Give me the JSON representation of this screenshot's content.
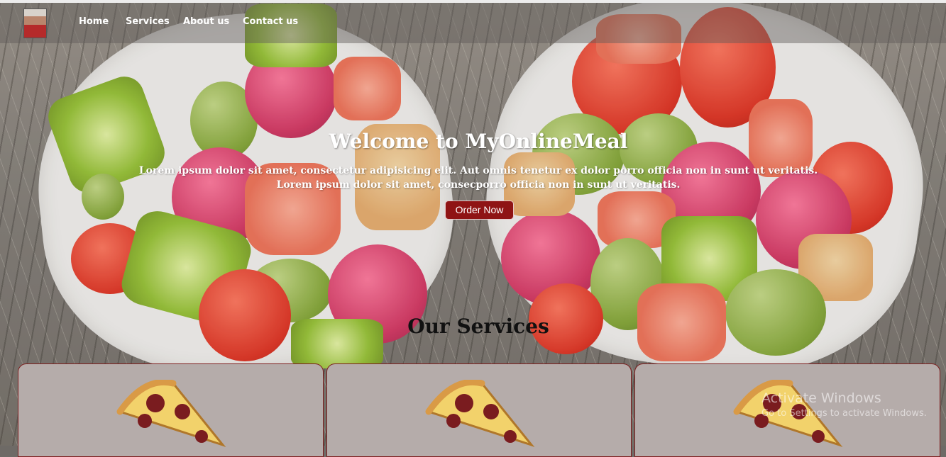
{
  "nav": {
    "links": [
      "Home",
      "Services",
      "About us",
      "Contact us"
    ]
  },
  "hero": {
    "title": "Welcome to MyOnlineMeal",
    "line1": "Lorem ipsum dolor sit amet, consectetur adipisicing elit. Aut omnis tenetur ex dolor porro officia non in sunt ut veritatis.",
    "line2": "Lorem ipsum dolor sit amet, consecporro officia non in sunt ut veritatis.",
    "button": "Order Now"
  },
  "services": {
    "title": "Our Services",
    "cards": [
      {
        "icon": "pizza-icon"
      },
      {
        "icon": "pizza-icon"
      },
      {
        "icon": "pizza-icon"
      }
    ]
  },
  "watermark": {
    "title": "Activate Windows",
    "subtitle": "Go to Settings to activate Windows."
  },
  "colors": {
    "accent": "#8f1414",
    "card": "#b5acaa"
  }
}
